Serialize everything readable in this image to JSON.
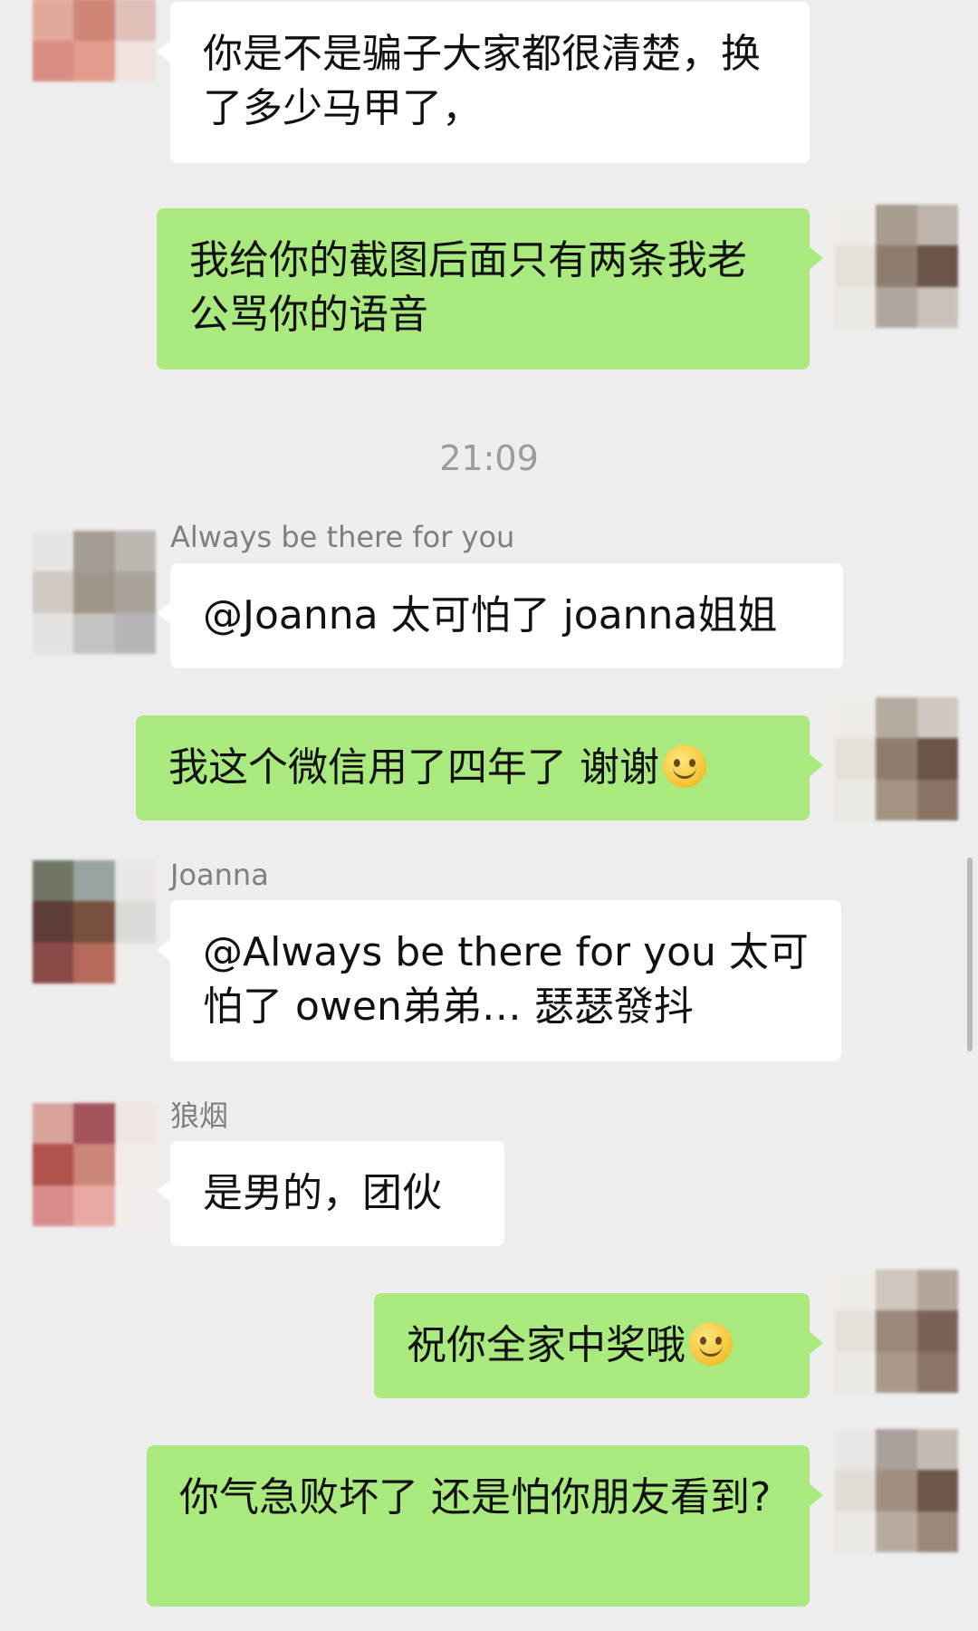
{
  "messages": [
    {
      "text": "你是不是骗子大家都很清楚，换了多少马甲了，"
    },
    {
      "text": "我给你的截图后面只有两条我老公骂你的语音"
    },
    {
      "time": "21:09"
    },
    {
      "sender": "Always be there for you",
      "text": "@Joanna 太可怕了 joanna姐姐"
    },
    {
      "text": "我这个微信用了四年了 谢谢",
      "emoji": "smile-emoji"
    },
    {
      "sender": "Joanna",
      "text": "@Always be there for you 太可怕了 owen弟弟… 瑟瑟發抖"
    },
    {
      "sender": "狼烟",
      "text": "是男的，团伙"
    },
    {
      "text": "祝你全家中奖哦",
      "emoji": "smile-emoji"
    },
    {
      "text": "你气急败坏了 还是怕你朋友看到?"
    }
  ],
  "colors": {
    "background": "#ededed",
    "outgoing_bubble": "#a9e97e",
    "incoming_bubble": "#ffffff",
    "sender_name": "#7f7f7f",
    "timestamp": "#9b9b9b"
  }
}
